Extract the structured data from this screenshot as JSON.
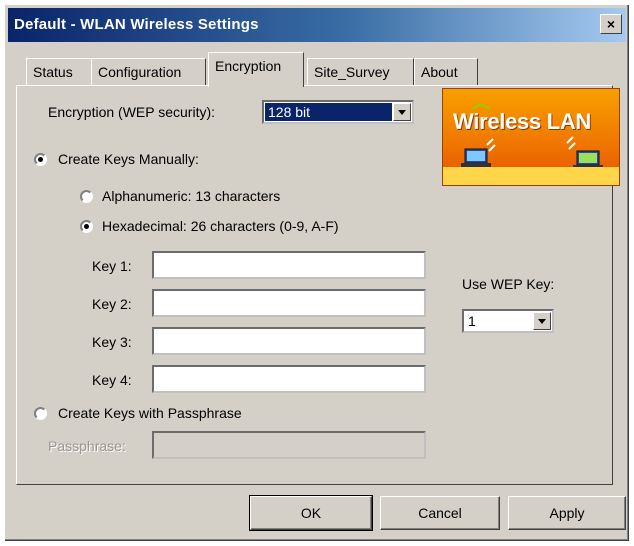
{
  "window": {
    "title": "Default - WLAN Wireless Settings",
    "close_symbol": "×"
  },
  "tabs": [
    {
      "label": "Status",
      "active": false
    },
    {
      "label": "Configuration",
      "active": false
    },
    {
      "label": "Encryption",
      "active": true
    },
    {
      "label": "Site_Survey",
      "active": false
    },
    {
      "label": "About",
      "active": false
    }
  ],
  "encryption": {
    "label": "Encryption (WEP security):",
    "selected": "128 bit"
  },
  "logo": {
    "text": "Wireless LAN",
    "icons": [
      "laptop-icon",
      "antenna-icon"
    ]
  },
  "manual": {
    "label": "Create Keys Manually:",
    "checked": true,
    "alphanumeric": {
      "label": "Alphanumeric: 13 characters",
      "checked": false
    },
    "hexadecimal": {
      "label": "Hexadecimal: 26 characters (0-9, A-F)",
      "checked": true
    },
    "keys": [
      {
        "label": "Key 1:",
        "value": ""
      },
      {
        "label": "Key 2:",
        "value": ""
      },
      {
        "label": "Key 3:",
        "value": ""
      },
      {
        "label": "Key 4:",
        "value": ""
      }
    ]
  },
  "use_wep_key": {
    "label": "Use WEP Key:",
    "selected": "1"
  },
  "passphrase": {
    "radio_label": "Create Keys with Passphrase",
    "checked": false,
    "field_label": "Passphrase:",
    "value": ""
  },
  "buttons": {
    "ok": "OK",
    "cancel": "Cancel",
    "apply": "Apply"
  },
  "colors": {
    "titlebar_start": "#0a246a",
    "titlebar_end": "#a6caf0",
    "dialog_face": "#d4d0c8",
    "logo_orange": "#f07800",
    "logo_yellow": "#ffd64a"
  }
}
